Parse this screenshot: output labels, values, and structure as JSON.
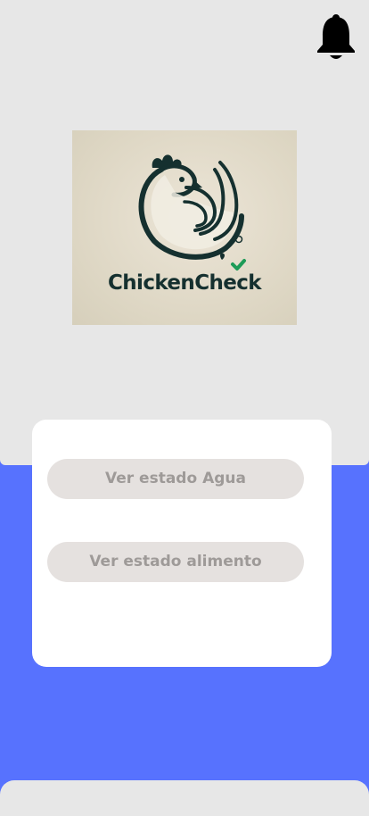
{
  "header": {
    "notification_icon": "bell-icon"
  },
  "logo": {
    "brand_text": "ChickenCheck",
    "icon": "chicken-icon"
  },
  "card": {
    "water_button_label": "Ver estado Agua",
    "food_button_label": "Ver estado alimento"
  },
  "colors": {
    "top_background": "#e7e7e7",
    "bottom_background": "#5772fe",
    "card_background": "#ffffff",
    "button_background": "#e5e1df",
    "button_text": "#9e9a98",
    "logo_background": "#ddd6c3",
    "logo_ink": "#15302f",
    "check_green": "#1d9b57"
  }
}
